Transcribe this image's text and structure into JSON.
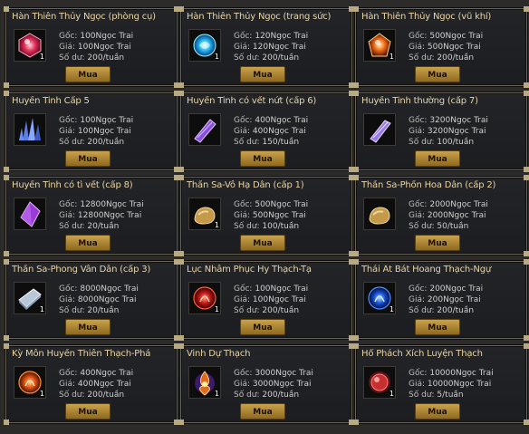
{
  "labels": {
    "original": "Gốc:",
    "price": "Giá:",
    "remaining": "Số dư:"
  },
  "buy_label": "Mua",
  "items": [
    {
      "name": "Hàn Thiên Thủy Ngọc (phòng cụ)",
      "icon": "red-gem-icon",
      "qty": "1",
      "original": "100Ngọc Trai",
      "price": "100Ngọc Trai",
      "remaining": "200/tuần"
    },
    {
      "name": "Hàn Thiên Thủy Ngọc (trang sức)",
      "icon": "blue-gem-icon",
      "qty": "1",
      "original": "120Ngọc Trai",
      "price": "120Ngọc Trai",
      "remaining": "200/tuần"
    },
    {
      "name": "Hàn Thiên Thủy Ngọc (vũ khí)",
      "icon": "orange-gem-icon",
      "qty": "1",
      "original": "500Ngọc Trai",
      "price": "500Ngọc Trai",
      "remaining": "200/tuần"
    },
    {
      "name": "Huyền Tinh Cấp 5",
      "icon": "blue-crystal-icon",
      "qty": "",
      "original": "100Ngọc Trai",
      "price": "100Ngọc Trai",
      "remaining": "200/tuần"
    },
    {
      "name": "Huyền Tinh có vết nứt (cấp 6)",
      "icon": "purple-crystal-icon",
      "qty": "",
      "original": "400Ngọc Trai",
      "price": "400Ngọc Trai",
      "remaining": "150/tuần"
    },
    {
      "name": "Huyền Tinh thường (cấp 7)",
      "icon": "violet-crystal-icon",
      "qty": "",
      "original": "3200Ngọc Trai",
      "price": "3200Ngọc Trai",
      "remaining": "100/tuần"
    },
    {
      "name": "Huyền Tinh có tì vết (cấp 8)",
      "icon": "amethyst-icon",
      "qty": "",
      "original": "12800Ngọc Trai",
      "price": "12800Ngọc Trai",
      "remaining": "20/tuần"
    },
    {
      "name": "Thần Sa-Vô Hạ Dẫn (cấp 1)",
      "icon": "gold-ore-icon",
      "qty": "1",
      "original": "500Ngọc Trai",
      "price": "500Ngọc Trai",
      "remaining": "100/tuần"
    },
    {
      "name": "Thần Sa-Phồn Hoa Dẫn (cấp 2)",
      "icon": "gold-ore-icon",
      "qty": "",
      "original": "2000Ngọc Trai",
      "price": "2000Ngọc Trai",
      "remaining": "50/tuần"
    },
    {
      "name": "Thần Sa-Phong Vân Dẫn (cấp 3)",
      "icon": "silver-ingot-icon",
      "qty": "1",
      "original": "8000Ngọc Trai",
      "price": "8000Ngọc Trai",
      "remaining": "20/tuần"
    },
    {
      "name": "Lục Nhâm Phục Hy Thạch-Tạ",
      "icon": "red-orb-icon",
      "qty": "1",
      "original": "100Ngọc Trai",
      "price": "100Ngọc Trai",
      "remaining": "200/tuần"
    },
    {
      "name": "Thái Ất Bát Hoang Thạch-Ngự",
      "icon": "blue-orb-icon",
      "qty": "1",
      "original": "200Ngọc Trai",
      "price": "200Ngọc Trai",
      "remaining": "200/tuần"
    },
    {
      "name": "Kỳ Môn Huyền Thiên Thạch-Phá",
      "icon": "orange-orb-icon",
      "qty": "1",
      "original": "400Ngọc Trai",
      "price": "400Ngọc Trai",
      "remaining": "200/tuần"
    },
    {
      "name": "Vinh Dự Thạch",
      "icon": "purple-flame-icon",
      "qty": "1",
      "original": "3000Ngọc Trai",
      "price": "3000Ngọc Trai",
      "remaining": "200/tuần"
    },
    {
      "name": "Hổ Phách Xích Luyện Thạch",
      "icon": "amber-stone-icon",
      "qty": "1",
      "original": "10000Ngọc Trai",
      "price": "10000Ngọc Trai",
      "remaining": "5/tuần"
    }
  ]
}
